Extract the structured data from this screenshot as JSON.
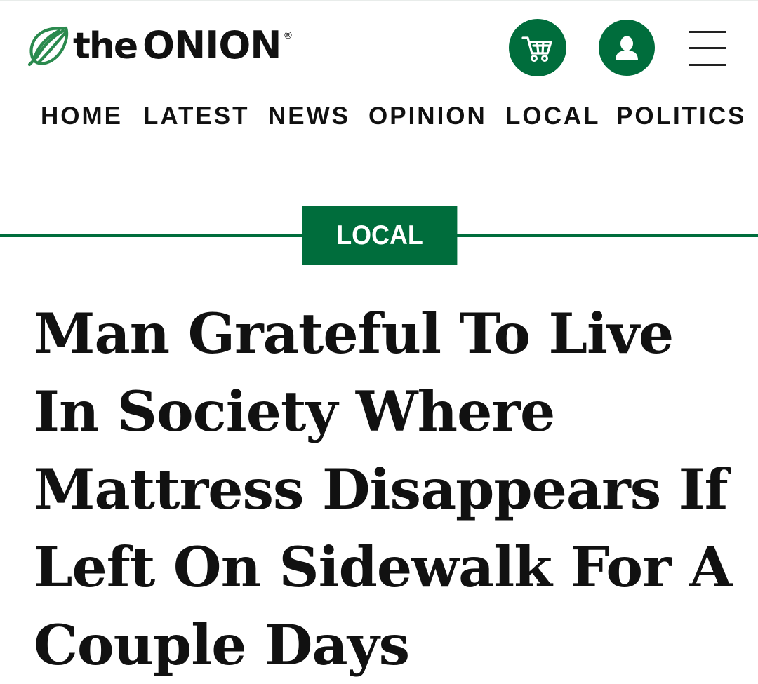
{
  "brand": {
    "name_prefix": "the",
    "name_main": "ONION",
    "registered_mark": "®",
    "logo_icon": "onion-logo-icon",
    "accent_color": "#006d3c"
  },
  "header": {
    "cart_icon": "cart-icon",
    "account_icon": "user-icon",
    "menu_icon": "hamburger-menu-icon"
  },
  "nav": {
    "items": [
      {
        "label": "HOME"
      },
      {
        "label": "LATEST"
      },
      {
        "label": "NEWS"
      },
      {
        "label": "OPINION"
      },
      {
        "label": "LOCAL"
      },
      {
        "label": "POLITICS"
      }
    ]
  },
  "article": {
    "section": "LOCAL",
    "headline": "Man Grateful To Live In Society Where Mattress Disappears If Left On Sidewalk For A Couple Days"
  }
}
